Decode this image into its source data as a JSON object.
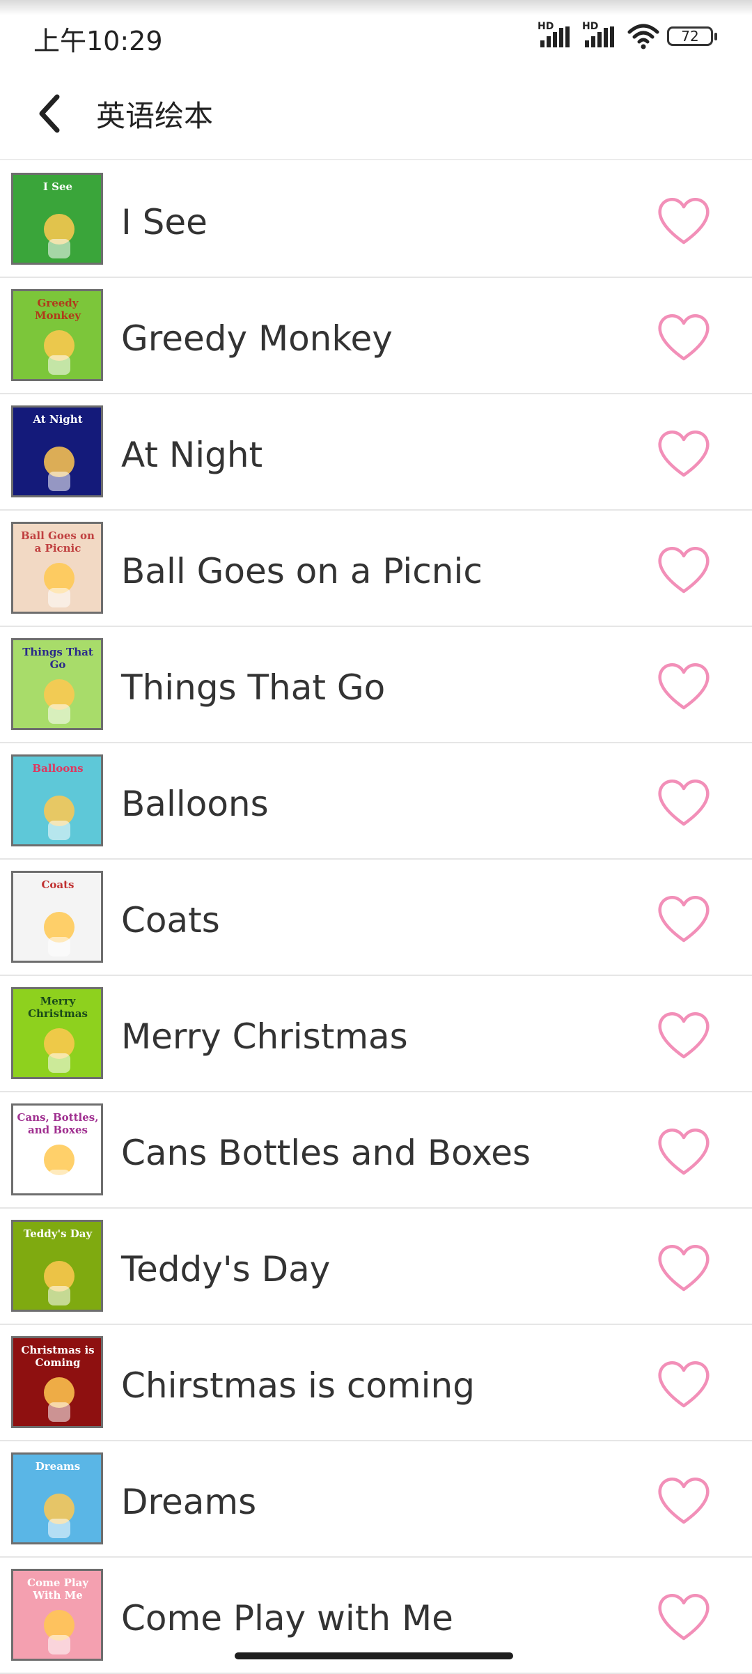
{
  "status_bar": {
    "time": "上午10:29",
    "signal1_label": "HD",
    "signal2_label": "HD",
    "battery_level": "72"
  },
  "header": {
    "title": "英语绘本"
  },
  "colors": {
    "heart_outline": "#f28fb8",
    "divider": "#e6e6e6",
    "text": "#333333"
  },
  "books": [
    {
      "title": "I See",
      "cover_text": "I See",
      "cover_bg": "#3aa53a",
      "cover_fg": "#ffffff",
      "favorite": false
    },
    {
      "title": "Greedy Monkey",
      "cover_text": "Greedy Monkey",
      "cover_bg": "#7cc63a",
      "cover_fg": "#b03a1a",
      "favorite": false
    },
    {
      "title": "At Night",
      "cover_text": "At Night",
      "cover_bg": "#141a7a",
      "cover_fg": "#ffffff",
      "favorite": false
    },
    {
      "title": "Ball Goes on a Picnic",
      "cover_text": "Ball Goes on a Picnic",
      "cover_bg": "#f2d9c4",
      "cover_fg": "#c04040",
      "favorite": false
    },
    {
      "title": "Things That Go",
      "cover_text": "Things That Go",
      "cover_bg": "#a8dc6a",
      "cover_fg": "#2a2a8a",
      "favorite": false
    },
    {
      "title": "Balloons",
      "cover_text": "Balloons",
      "cover_bg": "#5ec8d8",
      "cover_fg": "#e0365e",
      "favorite": false
    },
    {
      "title": "Coats",
      "cover_text": "Coats",
      "cover_bg": "#f4f4f4",
      "cover_fg": "#c03030",
      "favorite": false
    },
    {
      "title": "Merry Christmas",
      "cover_text": "Merry Christmas",
      "cover_bg": "#8ed11e",
      "cover_fg": "#1a4a1a",
      "favorite": false
    },
    {
      "title": "Cans Bottles and Boxes",
      "cover_text": "Cans, Bottles, and Boxes",
      "cover_bg": "#ffffff",
      "cover_fg": "#a03090",
      "favorite": false
    },
    {
      "title": "Teddy's Day",
      "cover_text": "Teddy's Day",
      "cover_bg": "#7faa10",
      "cover_fg": "#ffffff",
      "favorite": false
    },
    {
      "title": "Chirstmas is coming",
      "cover_text": "Christmas is Coming",
      "cover_bg": "#8e1010",
      "cover_fg": "#ffffff",
      "favorite": false
    },
    {
      "title": "Dreams",
      "cover_text": "Dreams",
      "cover_bg": "#5ab6e6",
      "cover_fg": "#ffffff",
      "favorite": false
    },
    {
      "title": "Come Play with Me",
      "cover_text": "Come Play With Me",
      "cover_bg": "#f4a0b0",
      "cover_fg": "#ffffff",
      "favorite": false
    }
  ]
}
